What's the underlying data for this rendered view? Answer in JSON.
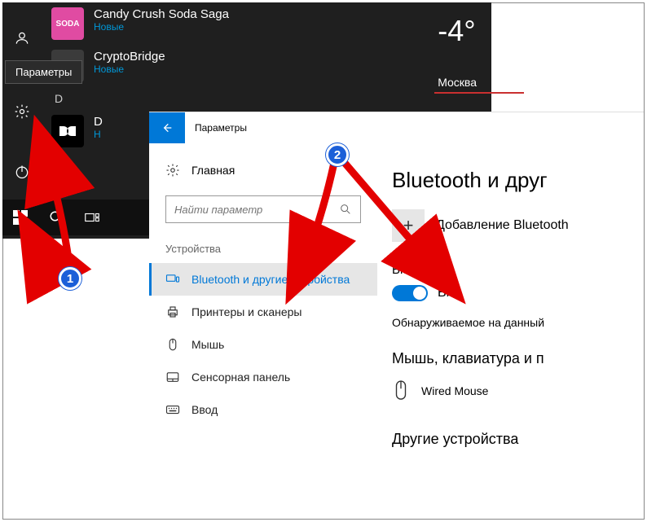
{
  "startmenu": {
    "tooltip": "Параметры",
    "apps": [
      {
        "title": "Candy Crush Soda Saga",
        "sub": "Новые",
        "icon_bg": "#e04ba2",
        "icon_text": "SODA"
      },
      {
        "title": "CryptoBridge",
        "sub": "Новые",
        "icon_bg": "#3b3b3b",
        "icon_text": ""
      }
    ],
    "letter": "D",
    "dolby_prefix": "D",
    "dolby_sub": "Н"
  },
  "weather": {
    "temp": "-4°",
    "city": "Москва"
  },
  "settings": {
    "title": "Параметры",
    "home": "Главная",
    "search_placeholder": "Найти параметр",
    "category": "Устройства",
    "nav": {
      "bluetooth": "Bluetooth и другие устройства",
      "printers": "Принтеры и сканеры",
      "mouse": "Мышь",
      "touchpad": "Сенсорная панель",
      "typing": "Ввод"
    },
    "right": {
      "header": "Bluetooth и друг",
      "add": "Добавление Bluetooth",
      "bt_label": "Bluetooth",
      "bt_state": "Вкл.",
      "discover": "Обнаруживаемое на данный",
      "mk_header": "Мышь, клавиатура и п",
      "device": "Wired Mouse",
      "other_header": "Другие устройства"
    }
  },
  "badges": {
    "one": "1",
    "two": "2"
  }
}
